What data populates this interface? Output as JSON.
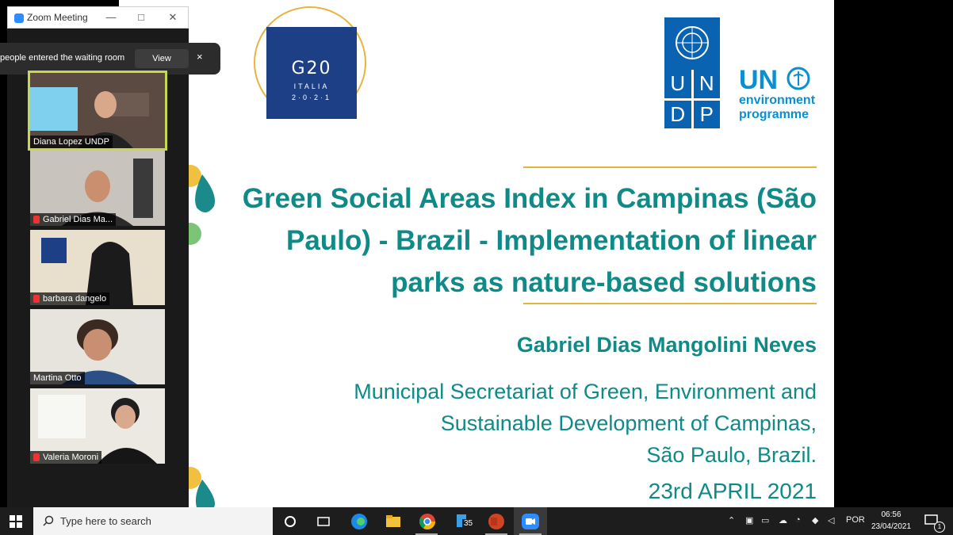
{
  "slide": {
    "g20": {
      "text": "G20",
      "sub": "ITALIA",
      "year": "2·0·2·1"
    },
    "undp_letters": [
      "U",
      "N",
      "D",
      "P"
    ],
    "unep": {
      "un": "UN",
      "env": "environment",
      "prog": "programme"
    },
    "title_lines": [
      "Green Social Areas Index in Campinas (São",
      "Paulo) - Brazil - Implementation of linear",
      "parks as nature-based solutions"
    ],
    "author": "Gabriel Dias Mangolini Neves",
    "affiliation_lines": [
      "Municipal Secretariat of Green, Environment and",
      "Sustainable Development of Campinas,",
      "São Paulo, Brazil."
    ],
    "date": "23rd APRIL 2021",
    "accent_color": "#0f8a87",
    "rule_color": "#e2b53e"
  },
  "zoom": {
    "window_title": "Zoom Meeting",
    "notification": "people entered the waiting room",
    "view_label": "View",
    "close_glyph": "×",
    "participants": [
      {
        "name": "Diana Lopez UNDP",
        "muted": false,
        "active": true
      },
      {
        "name": "Gabriel Dias Ma...",
        "muted": true,
        "active": false
      },
      {
        "name": "barbara dangelo",
        "muted": true,
        "active": false
      },
      {
        "name": "Martina Otto",
        "muted": false,
        "active": false
      },
      {
        "name": "Valeria Moroni",
        "muted": true,
        "active": false
      }
    ]
  },
  "taskbar": {
    "search_placeholder": "Type here to search",
    "badge": "35",
    "language": "POR",
    "time": "06:56",
    "date": "23/04/2021",
    "notif_count": "1"
  }
}
